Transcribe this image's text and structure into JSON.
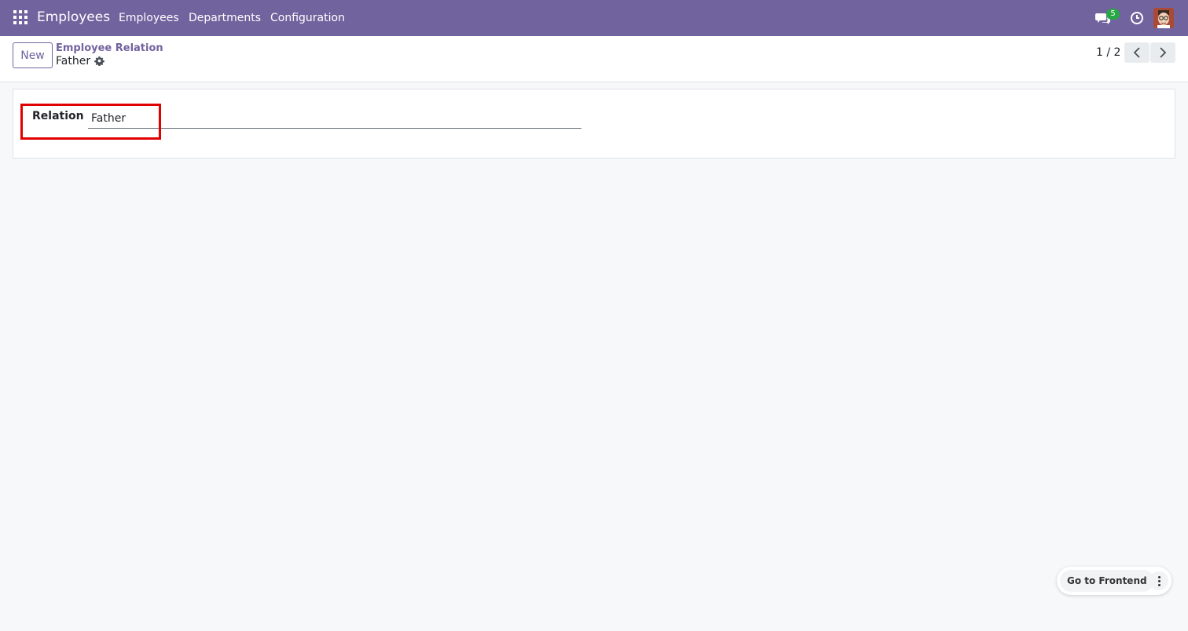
{
  "navbar": {
    "app_name": "Employees",
    "menu": [
      "Employees",
      "Departments",
      "Configuration"
    ],
    "chat_badge": "5",
    "accent_color": "#71639e"
  },
  "control_panel": {
    "new_label": "New",
    "breadcrumb_parent": "Employee Relation",
    "breadcrumb_current": "Father",
    "pager": "1 / 2"
  },
  "form": {
    "relation_label": "Relation",
    "relation_value": "Father"
  },
  "frontend": {
    "go_label": "Go to Frontend"
  },
  "colors": {
    "highlight": "#e00000",
    "badge": "#28a745"
  }
}
